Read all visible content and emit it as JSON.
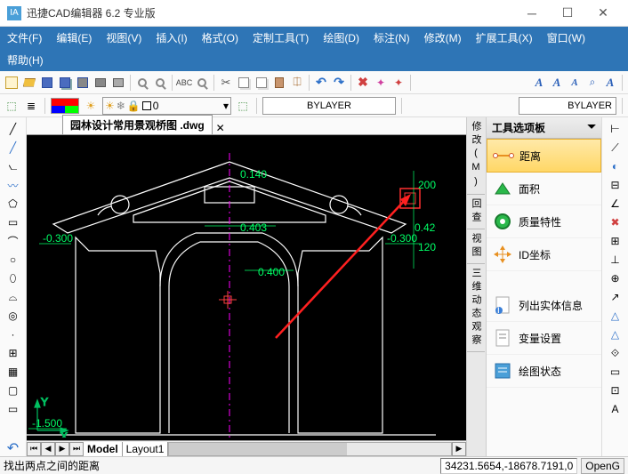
{
  "titlebar": {
    "title": "迅捷CAD编辑器 6.2 专业版",
    "icon": "IA"
  },
  "menus": [
    "文件(F)",
    "编辑(E)",
    "视图(V)",
    "插入(I)",
    "格式(O)",
    "定制工具(T)",
    "绘图(D)",
    "标注(N)",
    "修改(M)",
    "扩展工具(X)",
    "窗口(W)",
    "帮助(H)"
  ],
  "propbar": {
    "bylayer1": "BYLAYER",
    "bylayer2": "BYLAYER",
    "layer_name": "0"
  },
  "file_tab": "园林设计常用景观桥图 .dwg",
  "model_tabs": {
    "model": "Model",
    "layout1": "Layout1"
  },
  "right_tabs": [
    "修改(M)",
    "回查",
    "视图",
    "三维动态观察"
  ],
  "palette": {
    "title": "工具选项板",
    "items": [
      "距离",
      "面积",
      "质量特性",
      "ID坐标",
      "列出实体信息",
      "变量设置",
      "绘图状态"
    ]
  },
  "status": {
    "hint": "找出两点之间的距离",
    "coord": "34231.5654,-18678.7191,0",
    "mode": "OpenG"
  },
  "cad_labels": {
    "d140": "0.140",
    "d403": "0.403",
    "d400": "0.400",
    "n0300_l": "-0.300",
    "n0300_r": "-0.300",
    "d420": "0.420",
    "p200": "200",
    "p120": "120",
    "n1500": "-1.500"
  }
}
